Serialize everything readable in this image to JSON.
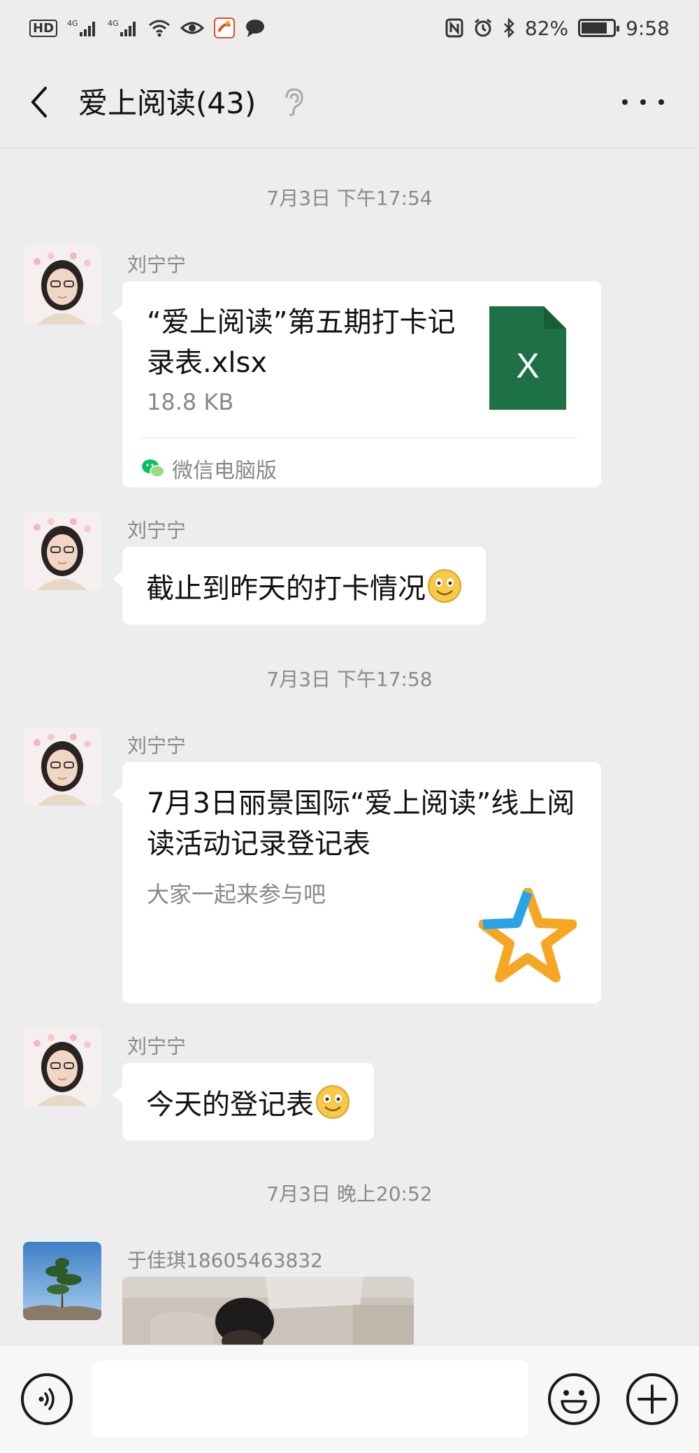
{
  "status_bar": {
    "hd": "HD",
    "network_1": "4G",
    "network_2": "4G",
    "battery_percent": "82%",
    "battery_level": 0.82,
    "time": "9:58"
  },
  "header": {
    "title": "爱上阅读(43)"
  },
  "messages": [
    {
      "type": "time",
      "text": "7月3日 下午17:54"
    },
    {
      "type": "file",
      "sender": "刘宁宁",
      "file_name": "“爱上阅读”第五期打卡记录表.xlsx",
      "file_size": "18.8 KB",
      "file_icon_letter": "X",
      "source": "微信电脑版"
    },
    {
      "type": "text",
      "sender": "刘宁宁",
      "text": "截止到昨天的打卡情况",
      "emoji": "smile-icon"
    },
    {
      "type": "time",
      "text": "7月3日 下午17:58"
    },
    {
      "type": "link",
      "sender": "刘宁宁",
      "title": "7月3日丽景国际“爱上阅读”线上阅读活动记录登记表",
      "description": "大家一起来参与吧"
    },
    {
      "type": "text",
      "sender": "刘宁宁",
      "text": "今天的登记表",
      "emoji": "smile-icon"
    },
    {
      "type": "time",
      "text": "7月3日 晚上20:52"
    },
    {
      "type": "image",
      "sender": "于佳琪18605463832"
    }
  ],
  "colors": {
    "background": "#ededed",
    "bubble": "#ffffff",
    "excel_green": "#1e7145",
    "wechat_green": "#07c160"
  }
}
